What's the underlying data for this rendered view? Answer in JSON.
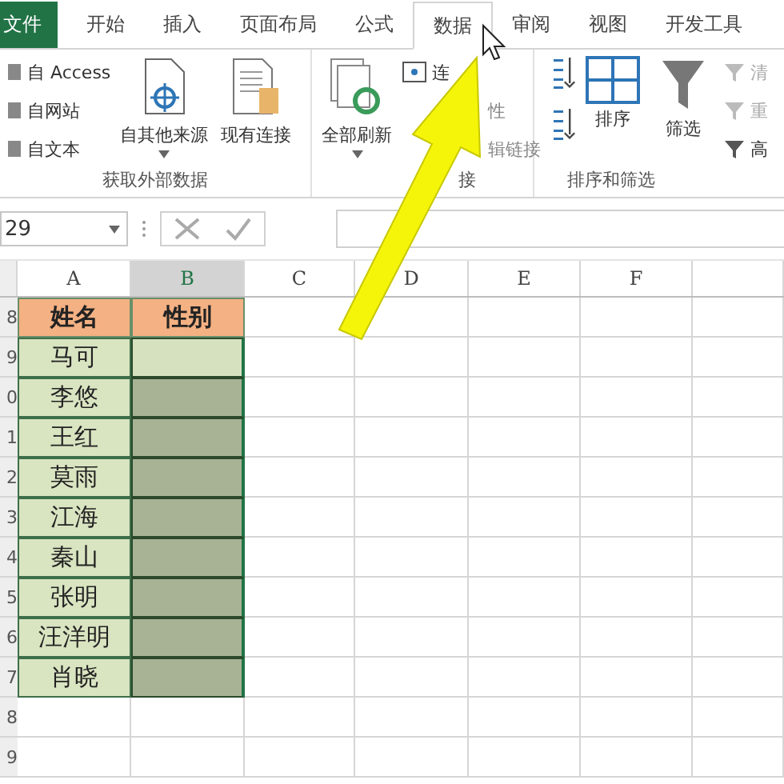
{
  "tabs": [
    {
      "label": "文件",
      "kind": "file",
      "selected": false
    },
    {
      "label": "开始",
      "kind": "tab",
      "selected": false
    },
    {
      "label": "插入",
      "kind": "tab",
      "selected": false
    },
    {
      "label": "页面布局",
      "kind": "tab",
      "selected": false
    },
    {
      "label": "公式",
      "kind": "tab",
      "selected": false
    },
    {
      "label": "数据",
      "kind": "tab",
      "selected": true
    },
    {
      "label": "审阅",
      "kind": "tab",
      "selected": false
    },
    {
      "label": "视图",
      "kind": "tab",
      "selected": false
    },
    {
      "label": "开发工具",
      "kind": "tab",
      "selected": false
    }
  ],
  "ribbon": {
    "external": {
      "small": [
        "自 Access",
        "自网站",
        "自文本"
      ],
      "other_sources": "自其他来源",
      "existing": "现有连接",
      "label": "获取外部数据"
    },
    "connections": {
      "refresh_all": "全部刷新",
      "small": [
        "连",
        "性",
        "辑链接"
      ],
      "label": "接"
    },
    "sort_filter": {
      "sort": "排序",
      "filter": "筛选",
      "small": [
        "清",
        "重",
        "高"
      ],
      "label": "排序和筛选"
    }
  },
  "formula_bar": {
    "name_box": "29"
  },
  "sheet": {
    "columns": [
      "A",
      "B",
      "C",
      "D",
      "E",
      "F"
    ],
    "rows": [
      {
        "row": "8",
        "kind": "header",
        "cells": [
          "姓名",
          "性别"
        ]
      },
      {
        "row": "9",
        "kind": "data",
        "name": "马可",
        "active": true
      },
      {
        "row": "0",
        "kind": "data",
        "name": "李悠",
        "active": false
      },
      {
        "row": "1",
        "kind": "data",
        "name": "王红",
        "active": false
      },
      {
        "row": "2",
        "kind": "data",
        "name": "莫雨",
        "active": false
      },
      {
        "row": "3",
        "kind": "data",
        "name": "江海",
        "active": false
      },
      {
        "row": "4",
        "kind": "data",
        "name": "秦山",
        "active": false
      },
      {
        "row": "5",
        "kind": "data",
        "name": "张明",
        "active": false
      },
      {
        "row": "6",
        "kind": "data",
        "name": "汪洋明",
        "active": false
      },
      {
        "row": "7",
        "kind": "data",
        "name": "肖晓",
        "active": false
      },
      {
        "row": "8",
        "kind": "empty"
      },
      {
        "row": "9",
        "kind": "empty"
      }
    ]
  }
}
